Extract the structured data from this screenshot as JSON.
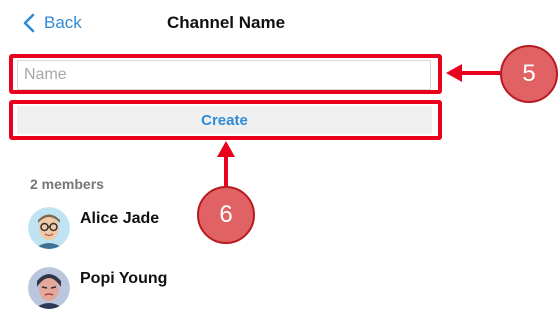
{
  "header": {
    "back_label": "Back",
    "title": "Channel Name"
  },
  "form": {
    "name_placeholder": "Name",
    "name_value": "",
    "create_label": "Create"
  },
  "annotations": {
    "callout_name": "5",
    "callout_create": "6",
    "highlight_color": "#e8001c",
    "callout_fill": "#e06264"
  },
  "members": {
    "count_label": "2 members",
    "list": [
      {
        "name": "Alice Jade",
        "avatar": "avatar-glasses-man-icon"
      },
      {
        "name": "Popi Young",
        "avatar": "avatar-woman-icon"
      }
    ]
  },
  "colors": {
    "accent": "#2f8bd6",
    "text": "#111111",
    "muted": "#777777"
  }
}
